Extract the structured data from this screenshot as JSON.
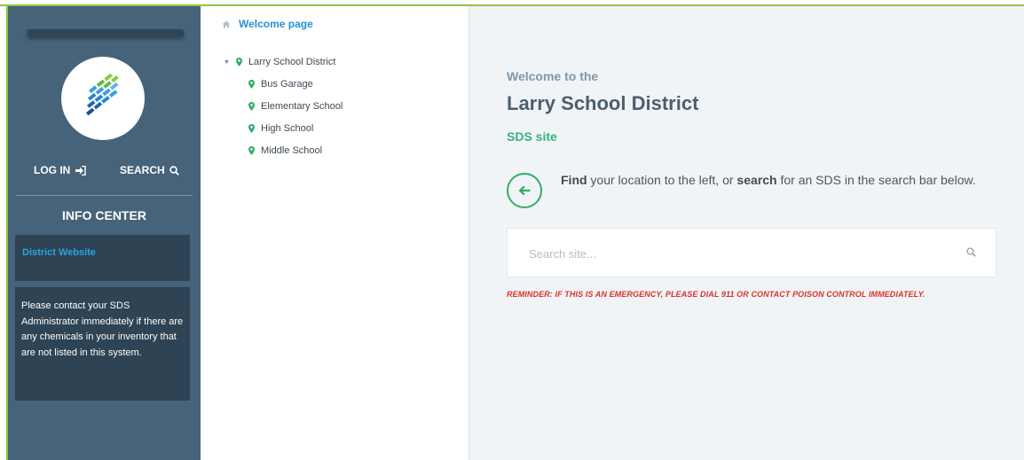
{
  "colors": {
    "sidebar_bg": "#46637a",
    "panel_bg": "#2e4353",
    "accent_green": "#36b37e",
    "link_blue": "#2a8fd0",
    "alert_red": "#d9322b",
    "main_bg": "#f1f4f6"
  },
  "sidebar": {
    "logo_icon": "district-logo",
    "login_label": "LOG IN",
    "login_icon": "sign-in-icon",
    "search_label": "SEARCH",
    "search_icon": "search-icon",
    "info_center_title": "INFO CENTER",
    "district_website_link": "District Website",
    "contact_message": "Please contact your SDS Administrator immediately if there are any chemicals in your inventory that are not listed in this system."
  },
  "tree": {
    "breadcrumb_icon": "home-icon",
    "breadcrumb_label": "Welcome page",
    "root": {
      "label": "Larry School District",
      "icon": "map-marker-icon",
      "expanded": true,
      "children": [
        {
          "label": "Bus Garage"
        },
        {
          "label": "Elementary School"
        },
        {
          "label": "High School"
        },
        {
          "label": "Middle School"
        }
      ]
    }
  },
  "main": {
    "welcome_prefix": "Welcome to the",
    "district_name": "Larry School District",
    "site_label": "SDS site",
    "find_bold": "Find",
    "find_middle": " your location to the left, or ",
    "search_bold": "search",
    "find_end": " for an SDS in the search bar below.",
    "search_placeholder": "Search site...",
    "reminder": "REMINDER: IF THIS IS AN EMERGENCY, PLEASE DIAL 911 OR CONTACT POISON CONTROL IMMEDIATELY."
  }
}
